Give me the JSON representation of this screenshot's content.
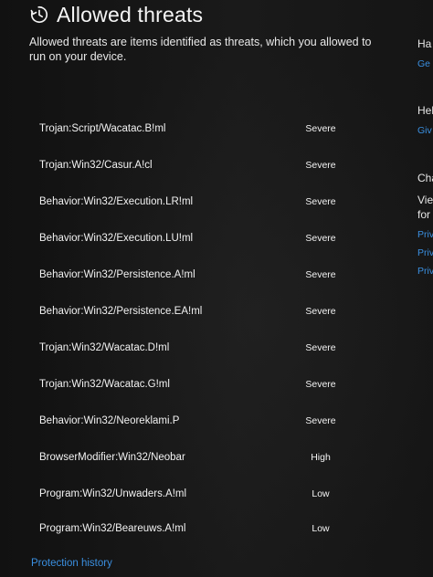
{
  "header": {
    "title": "Allowed threats",
    "icon": "history-icon"
  },
  "description": "Allowed threats are items identified as threats, which you allowed to run on your device.",
  "threats": [
    {
      "name": "Trojan:Script/Wacatac.B!ml",
      "severity": "Severe"
    },
    {
      "name": "Trojan:Win32/Casur.A!cl",
      "severity": "Severe"
    },
    {
      "name": "Behavior:Win32/Execution.LR!ml",
      "severity": "Severe"
    },
    {
      "name": "Behavior:Win32/Execution.LU!ml",
      "severity": "Severe"
    },
    {
      "name": "Behavior:Win32/Persistence.A!ml",
      "severity": "Severe"
    },
    {
      "name": "Behavior:Win32/Persistence.EA!ml",
      "severity": "Severe"
    },
    {
      "name": "Trojan:Win32/Wacatac.D!ml",
      "severity": "Severe"
    },
    {
      "name": "Trojan:Win32/Wacatac.G!ml",
      "severity": "Severe"
    },
    {
      "name": "Behavior:Win32/Neoreklami.P",
      "severity": "Severe"
    },
    {
      "name": "BrowserModifier:Win32/Neobar",
      "severity": "High"
    },
    {
      "name": "Program:Win32/Unwaders.A!ml",
      "severity": "Low"
    },
    {
      "name": "Program:Win32/Beareuws.A!ml",
      "severity": "Low"
    }
  ],
  "footer": {
    "protection_history_link": "Protection history"
  },
  "side_panel": {
    "items": [
      {
        "text": "Ha",
        "kind": "head"
      },
      {
        "text": "Ge",
        "kind": "link"
      },
      {
        "text": "Hel",
        "kind": "head"
      },
      {
        "text": "Giv",
        "kind": "link"
      },
      {
        "text": "Cha",
        "kind": "head"
      },
      {
        "text": "Vie",
        "kind": "head"
      },
      {
        "text": "for",
        "kind": "head"
      },
      {
        "text": "Priv",
        "kind": "link"
      },
      {
        "text": "Priv",
        "kind": "link"
      },
      {
        "text": "Priv",
        "kind": "link"
      }
    ]
  },
  "colors": {
    "background": "#141414",
    "text": "#f2f2f2",
    "link": "#3a8fe0"
  }
}
